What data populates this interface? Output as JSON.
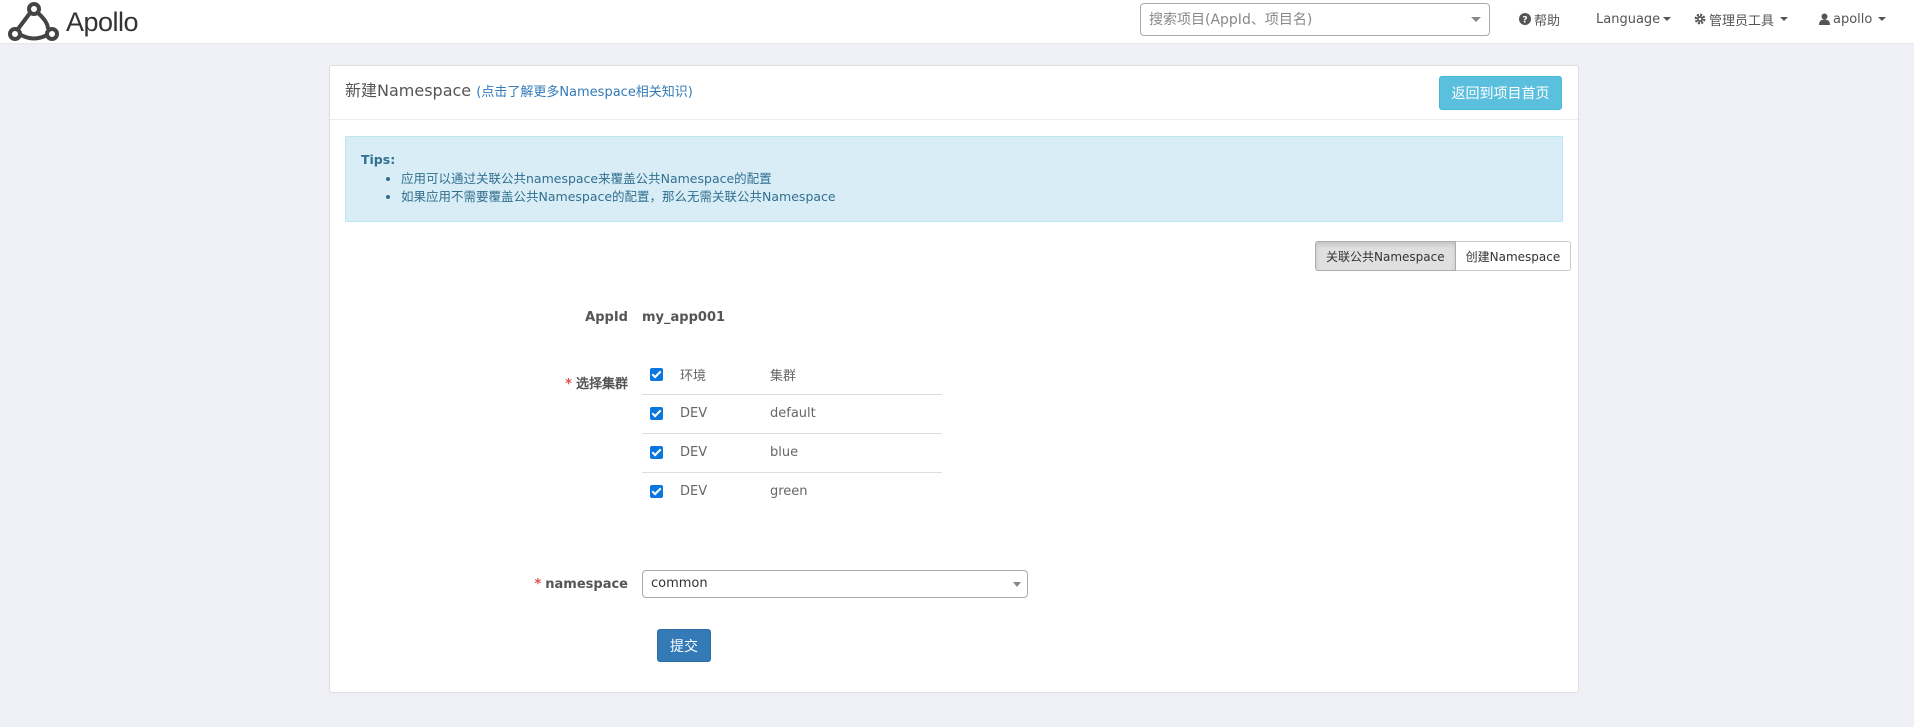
{
  "navbar": {
    "brand": "Apollo",
    "search_placeholder": "搜索项目(AppId、项目名)",
    "help": "帮助",
    "language": "Language",
    "admin_tools": "管理员工具",
    "user": "apollo"
  },
  "page": {
    "title": "新建Namespace",
    "help_link": "(点击了解更多Namespace相关知识)",
    "back_button": "返回到项目首页"
  },
  "tips": {
    "title": "Tips:",
    "items": [
      "应用可以通过关联公共namespace来覆盖公共Namespace的配置",
      "如果应用不需要覆盖公共Namespace的配置，那么无需关联公共Namespace"
    ]
  },
  "mode_toggle": {
    "link_public": "关联公共Namespace",
    "create": "创建Namespace",
    "active": "link_public"
  },
  "form": {
    "appid_label": "AppId",
    "appid_value": "my_app001",
    "required_mark": "*",
    "cluster_label": "选择集群",
    "cluster_header": {
      "env": "环境",
      "cluster": "集群",
      "checked": true
    },
    "clusters": [
      {
        "env": "DEV",
        "cluster": "default",
        "checked": true
      },
      {
        "env": "DEV",
        "cluster": "blue",
        "checked": true
      },
      {
        "env": "DEV",
        "cluster": "green",
        "checked": true
      }
    ],
    "namespace_label": "namespace",
    "namespace_value": "common",
    "submit": "提交"
  },
  "colors": {
    "primary": "#337ab7",
    "info": "#5bc0de",
    "tips_bg": "#d9edf7",
    "tips_text": "#31708f",
    "required": "#d9534f",
    "checkbox": "#0b75e0"
  },
  "icons": {
    "brand": "apollo-logo-icon",
    "help": "question-circle-icon",
    "admin": "gear-icon",
    "user": "user-icon"
  }
}
